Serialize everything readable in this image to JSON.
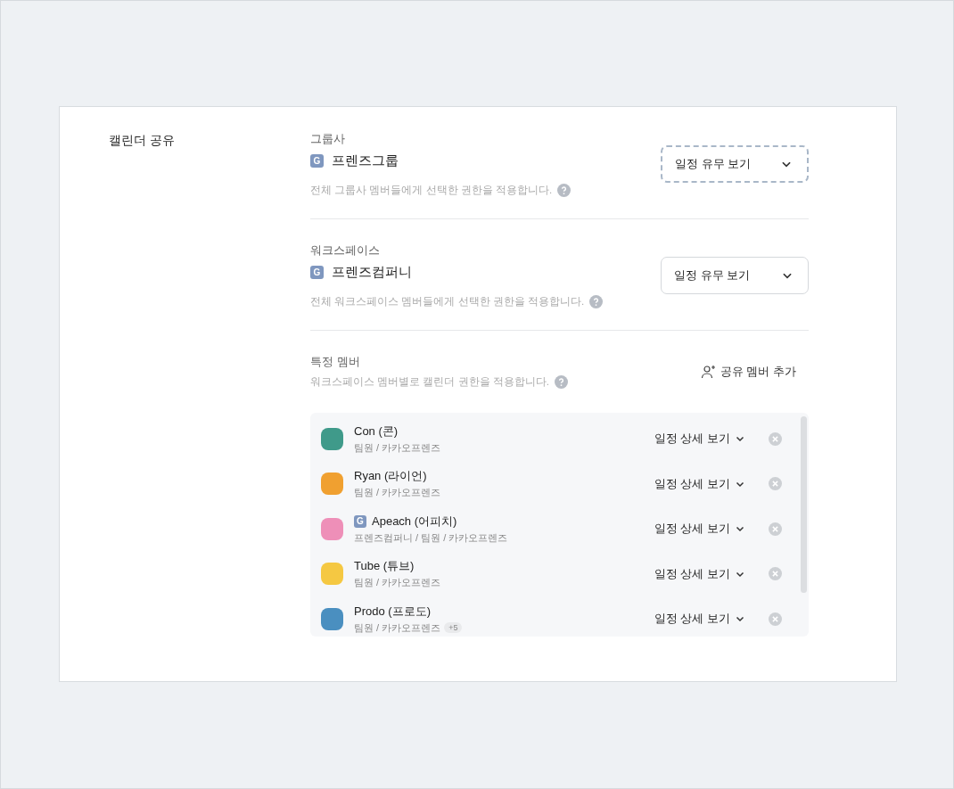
{
  "section_title": "캘린더 공유",
  "scopes": [
    {
      "heading": "그룹사",
      "badge": "G",
      "name": "프렌즈그룹",
      "permission": "일정 유무 보기",
      "focused": true,
      "description": "전체 그룹사 멤버들에게 선택한 권한을 적용합니다."
    },
    {
      "heading": "워크스페이스",
      "badge": "G",
      "name": "프렌즈컴퍼니",
      "permission": "일정 유무 보기",
      "focused": false,
      "description": "전체 워크스페이스 멤버들에게 선택한 권한을 적용합니다."
    }
  ],
  "members_section": {
    "heading": "특정 멤버",
    "description": "워크스페이스 멤버별로 캘린더 권한을 적용합니다.",
    "add_button": "공유 멤버 추가"
  },
  "members": [
    {
      "name": "Con (콘)",
      "subtitle": "팀원 / 카카오프렌즈",
      "permission": "일정 상세 보기",
      "color": "#3f9a8a"
    },
    {
      "name": "Ryan (라이언)",
      "subtitle": "팀원 / 카카오프렌즈",
      "permission": "일정 상세 보기",
      "color": "#f0a030"
    },
    {
      "name": "Apeach (어피치)",
      "badge": "G",
      "subtitle": "프렌즈컴퍼니 / 팀원 / 카카오프렌즈",
      "permission": "일정 상세 보기",
      "color": "#ee8fb8"
    },
    {
      "name": "Tube (튜브)",
      "subtitle": "팀원 / 카카오프렌즈",
      "permission": "일정 상세 보기",
      "color": "#f5c842"
    },
    {
      "name": "Prodo (프로도)",
      "subtitle": "팀원 / 카카오프렌즈",
      "extra": "+5",
      "permission": "일정 상세 보기",
      "color": "#4a8fc0"
    }
  ]
}
